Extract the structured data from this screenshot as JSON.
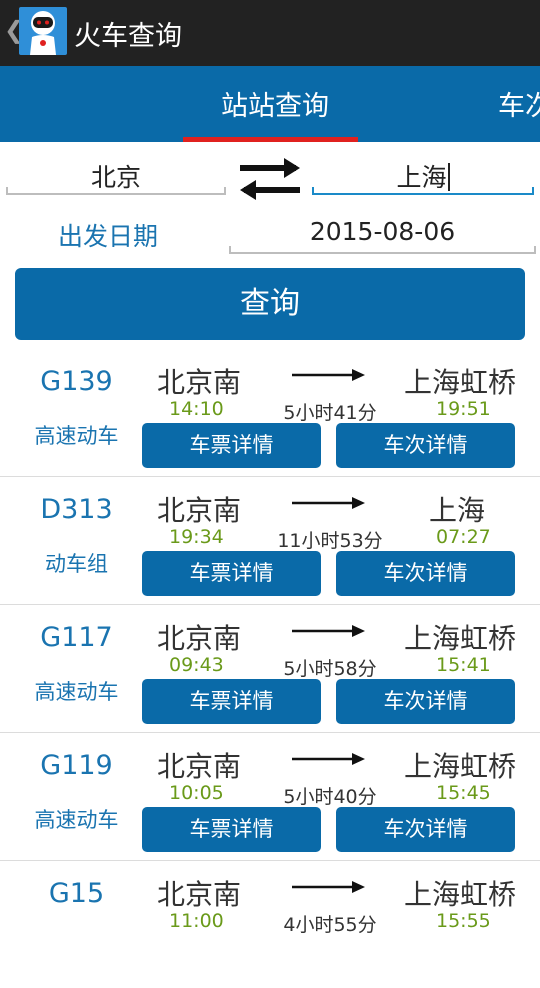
{
  "app": {
    "back_glyph": "❮",
    "title": "火车查询"
  },
  "tabs": [
    {
      "label": "站站查询"
    },
    {
      "label": "车次"
    }
  ],
  "search": {
    "from_station": "北京",
    "swap_icon": "swap-arrows-icon",
    "to_station": "上海",
    "date_label": "出发日期",
    "date_value": "2015-08-06",
    "query_button": "查询"
  },
  "trains": [
    {
      "no": "G139",
      "type": "高速动车",
      "from": "北京南",
      "to": "上海虹桥",
      "depart": "14:10",
      "duration": "5小时41分",
      "arrive": "19:51",
      "ticket_btn": "车票详情",
      "detail_btn": "车次详情"
    },
    {
      "no": "D313",
      "type": "动车组",
      "from": "北京南",
      "to": "上海",
      "depart": "19:34",
      "duration": "11小时53分",
      "arrive": "07:27",
      "ticket_btn": "车票详情",
      "detail_btn": "车次详情"
    },
    {
      "no": "G117",
      "type": "高速动车",
      "from": "北京南",
      "to": "上海虹桥",
      "depart": "09:43",
      "duration": "5小时58分",
      "arrive": "15:41",
      "ticket_btn": "车票详情",
      "detail_btn": "车次详情"
    },
    {
      "no": "G119",
      "type": "高速动车",
      "from": "北京南",
      "to": "上海虹桥",
      "depart": "10:05",
      "duration": "5小时40分",
      "arrive": "15:45",
      "ticket_btn": "车票详情",
      "detail_btn": "车次详情"
    },
    {
      "no": "G15",
      "type": "",
      "from": "北京南",
      "to": "上海虹桥",
      "depart": "11:00",
      "duration": "4小时55分",
      "arrive": "15:55",
      "ticket_btn": "",
      "detail_btn": ""
    }
  ],
  "colors": {
    "primary": "#0a6aa8",
    "accent": "#e0211f",
    "time": "#6a9a1a",
    "appbar": "#222222"
  }
}
